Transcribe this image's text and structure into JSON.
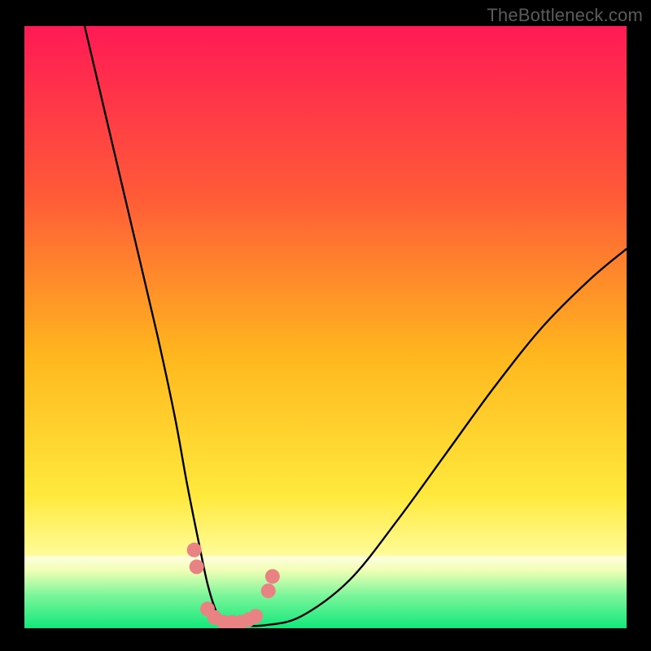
{
  "watermark": "TheBottleneck.com",
  "chart_data": {
    "type": "line",
    "title": "",
    "xlabel": "",
    "ylabel": "",
    "xlim": [
      0,
      100
    ],
    "ylim": [
      0,
      100
    ],
    "grid": false,
    "background_gradient": {
      "top_color": "#ff1a55",
      "mid_colors": [
        "#ff7430",
        "#ffd21a",
        "#fff85a"
      ],
      "bottom_color": "#11f07a"
    },
    "bottom_band": {
      "whitish": "#fffde0",
      "green": "#11f07a",
      "start_y": 88
    },
    "series": [
      {
        "name": "curve",
        "color": "#000000",
        "x": [
          10,
          14,
          18,
          22,
          25,
          27,
          29,
          30.5,
          32,
          33.5,
          35,
          40,
          46,
          54,
          62,
          70,
          78,
          86,
          94,
          100
        ],
        "y": [
          100,
          83,
          66,
          49,
          35,
          24,
          14,
          7,
          2.5,
          1,
          0.5,
          0.5,
          2,
          8,
          18,
          29,
          40,
          50,
          58,
          63
        ]
      }
    ],
    "markers": {
      "name": "dots",
      "color": "#e98383",
      "radius": 9,
      "x": [
        28.2,
        28.6,
        30.4,
        31.6,
        33.1,
        34.5,
        36.0,
        37.2,
        38.4,
        40.5,
        41.2
      ],
      "y": [
        13.0,
        10.2,
        3.2,
        1.8,
        1.0,
        1.0,
        1.0,
        1.4,
        2.0,
        6.2,
        8.6
      ]
    }
  }
}
